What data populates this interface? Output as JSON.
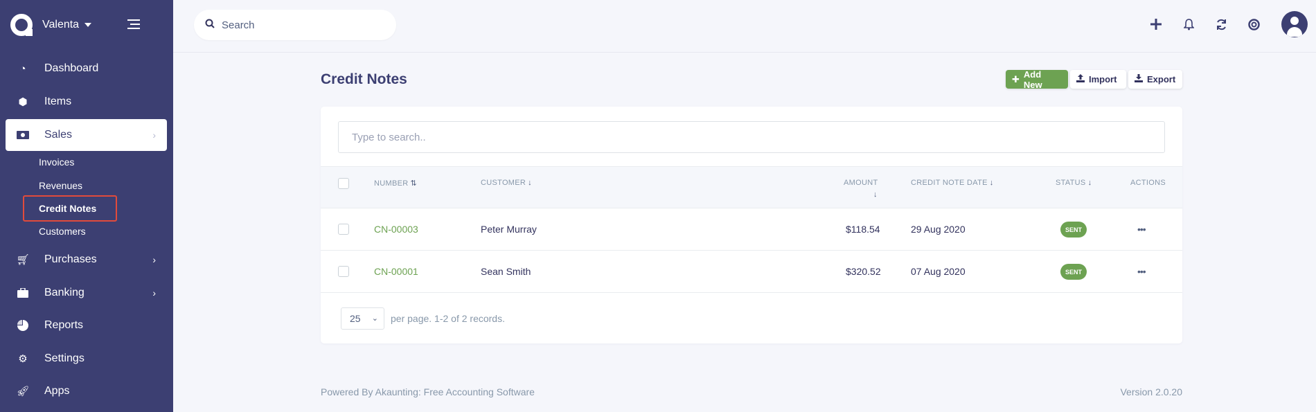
{
  "sidebar": {
    "company": "Valenta",
    "nav": [
      {
        "label": "Dashboard",
        "icon": "gauge-icon"
      },
      {
        "label": "Items",
        "icon": "cube-icon"
      },
      {
        "label": "Sales",
        "icon": "money-bill-icon"
      },
      {
        "label": "Purchases",
        "icon": "shopping-cart-icon"
      },
      {
        "label": "Banking",
        "icon": "briefcase-icon"
      },
      {
        "label": "Reports",
        "icon": "chart-pie-icon"
      },
      {
        "label": "Settings",
        "icon": "gear-icon"
      },
      {
        "label": "Apps",
        "icon": "rocket-icon"
      }
    ],
    "sales_sub": [
      "Invoices",
      "Revenues",
      "Credit Notes",
      "Customers"
    ]
  },
  "topbar": {
    "search_placeholder": "Search",
    "icons": [
      "plus-icon",
      "bell-icon",
      "refresh-icon",
      "life-ring-icon",
      "user-icon"
    ]
  },
  "page": {
    "title": "Credit Notes",
    "buttons": {
      "add": "Add New",
      "import": "Import",
      "export": "Export"
    }
  },
  "table": {
    "search_placeholder": "Type to search..",
    "headers": {
      "number": "NUMBER",
      "customer": "CUSTOMER",
      "amount": "AMOUNT",
      "date": "CREDIT NOTE DATE",
      "status": "STATUS",
      "actions": "ACTIONS"
    },
    "rows": [
      {
        "number": "CN-00003",
        "customer": "Peter Murray",
        "amount": "$118.54",
        "date": "29 Aug 2020",
        "status": "SENT"
      },
      {
        "number": "CN-00001",
        "customer": "Sean Smith",
        "amount": "$320.52",
        "date": "07 Aug 2020",
        "status": "SENT"
      }
    ],
    "per_page": "25",
    "pager_text": "per page. 1-2 of 2 records."
  },
  "footer": {
    "powered": "Powered By Akaunting: Free Accounting Software",
    "version": "Version 2.0.20"
  },
  "colors": {
    "sidebar": "#3c3f72",
    "accent": "#6da252",
    "highlight": "#e24b3b"
  }
}
